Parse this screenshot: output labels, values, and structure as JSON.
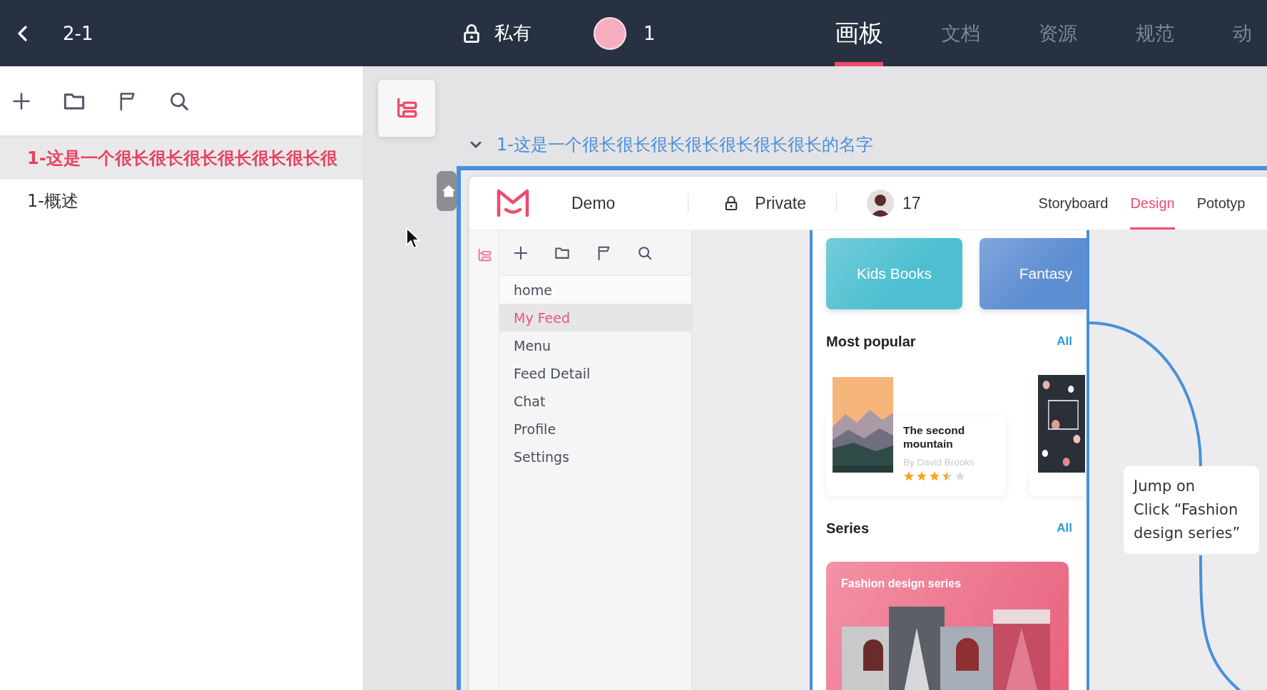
{
  "top_bar": {
    "title": "2-1",
    "visibility": "私有",
    "member_count": "1",
    "tabs": [
      {
        "label": "画板",
        "selected": true
      },
      {
        "label": "文档",
        "selected": false
      },
      {
        "label": "资源",
        "selected": false
      },
      {
        "label": "规范",
        "selected": false
      },
      {
        "label": "动",
        "selected": false
      }
    ]
  },
  "sidebar": {
    "pages": [
      {
        "label": "1-这是一个很长很长很长很长很长很长很",
        "selected": true
      },
      {
        "label": "1-概述",
        "selected": false
      }
    ]
  },
  "canvas": {
    "group": {
      "title": "1-这是一个很长很长很长很长很长很长很长的名字",
      "expanded": true
    },
    "prototype": {
      "header": {
        "project": "Demo",
        "visibility": "Private",
        "member_count": "17",
        "tabs": [
          {
            "label": "Storyboard",
            "selected": false
          },
          {
            "label": "Design",
            "selected": true
          },
          {
            "label": "Pototyp",
            "selected": false
          }
        ]
      },
      "pages": [
        {
          "label": "home",
          "selected": false
        },
        {
          "label": "My Feed",
          "selected": true
        },
        {
          "label": "Menu",
          "selected": false
        },
        {
          "label": "Feed Detail",
          "selected": false
        },
        {
          "label": "Chat",
          "selected": false
        },
        {
          "label": "Profile",
          "selected": false
        },
        {
          "label": "Settings",
          "selected": false
        }
      ],
      "screen": {
        "categories": [
          {
            "label": "Kids Books",
            "color": "#4dbfd0"
          },
          {
            "label": "Fantasy",
            "color": "#5e8ed2"
          }
        ],
        "popular": {
          "title": "Most popular",
          "link": "All",
          "books": [
            {
              "kind": "book",
              "title": "The second mountain",
              "author": "By David Brooks",
              "stars": 3.5
            },
            {
              "kind": "cover"
            }
          ]
        },
        "series": {
          "title": "Series",
          "link": "All",
          "cards": [
            {
              "title": "Fashion design series"
            }
          ]
        }
      }
    },
    "note": {
      "text": "Jump on\nClick “Fashion\ndesign series”"
    }
  }
}
